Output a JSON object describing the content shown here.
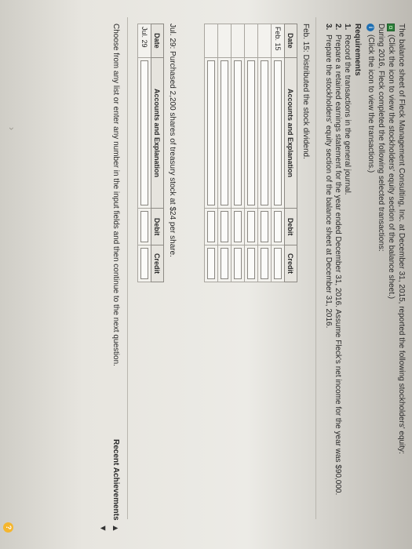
{
  "intro": {
    "line1": "The balance sheet of Fleck Management Consulting, Inc. at December 31, 2015, reported the following stockholders' equity:",
    "line2": "(Click the icon to view the stockholders' equity section of the balance sheet.)",
    "line3": "During 2016, Fleck completed the following selected transactions:",
    "line4": "(Click the icon to view the transactions.)"
  },
  "requirements": {
    "title": "Requirements",
    "items": [
      {
        "num": "1.",
        "text": "Record the transactions in the general journal."
      },
      {
        "num": "2.",
        "text": "Prepare a retained earnings statement for the year ended December 31, 2016. Assume Fleck's net income for the year was $90,000."
      },
      {
        "num": "3.",
        "text": "Prepare the stockholders' equity section of the balance sheet at December 31, 2016."
      }
    ]
  },
  "entry1": {
    "heading": "Feb. 15: Distributed the stock dividend.",
    "columns": {
      "date": "Date",
      "account": "Accounts and Explanation",
      "debit": "Debit",
      "credit": "Credit"
    },
    "date_value": "Feb. 15"
  },
  "entry2": {
    "heading": "Jul. 29: Purchased 2,200 shares of treasury stock at $24 per share.",
    "columns": {
      "date": "Date",
      "account": "Accounts and Explanation",
      "debit": "Debit",
      "credit": "Credit"
    },
    "date_value": "Jul. 29"
  },
  "footer": {
    "instruction": "Choose from any list or enter any number in the input fields and then continue to the next question.",
    "recent": "Recent Achievements"
  },
  "icons": {
    "info": "i",
    "help": "?",
    "nav_up": "▲",
    "nav_down": "▼",
    "sidebar": "›"
  }
}
